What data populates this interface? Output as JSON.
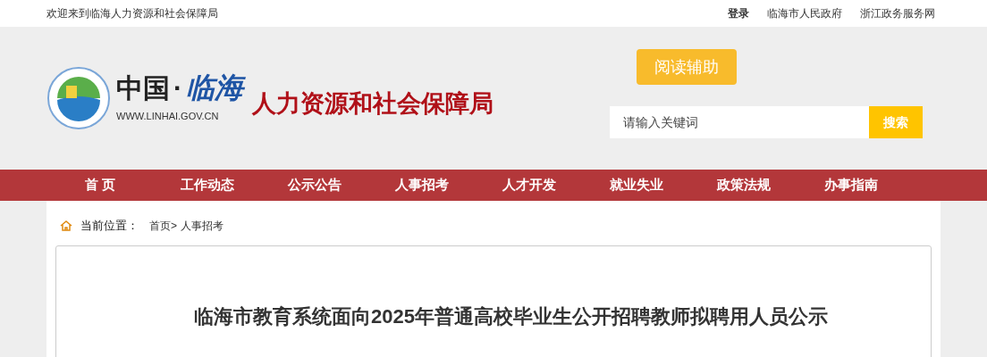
{
  "top_bar": {
    "welcome": "欢迎来到临海人力资源和社会保障局",
    "links": [
      "登录",
      "临海市人民政府",
      "浙江政务服务网"
    ]
  },
  "logo": {
    "country": "中国",
    "dot": "·",
    "city": "临海",
    "url": "WWW.LINHAI.GOV.CN",
    "agency": "人力资源和社会保障局"
  },
  "reading_aid_button": "阅读辅助",
  "search": {
    "placeholder": "请输入关键词",
    "button": "搜索"
  },
  "nav": [
    "首 页",
    "工作动态",
    "公示公告",
    "人事招考",
    "人才开发",
    "就业失业",
    "政策法规",
    "办事指南"
  ],
  "breadcrumb": {
    "label": "当前位置：",
    "path": [
      "首页>",
      "人事招考"
    ]
  },
  "article": {
    "title": "临海市教育系统面向2025年普通高校毕业生公开招聘教师拟聘用人员公示"
  }
}
